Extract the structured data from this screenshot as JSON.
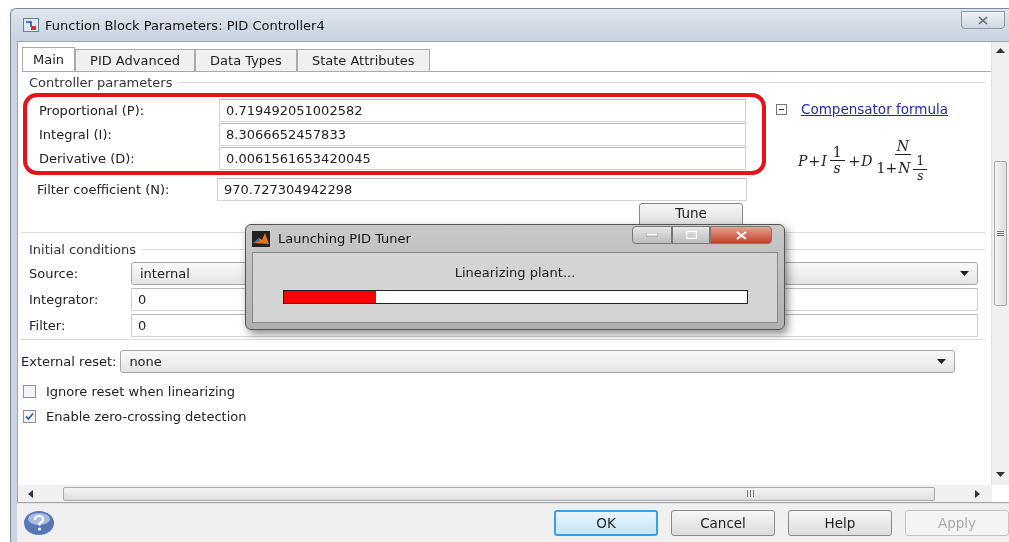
{
  "window": {
    "title": "Function Block Parameters: PID Controller4"
  },
  "tabs": [
    {
      "label": "Main",
      "selected": true
    },
    {
      "label": "PID Advanced",
      "selected": false
    },
    {
      "label": "Data Types",
      "selected": false
    },
    {
      "label": "State Attributes",
      "selected": false
    }
  ],
  "controller_parameters": {
    "title": "Controller parameters",
    "fields": [
      {
        "label": "Proportional (P):",
        "value": "0.719492051002582",
        "highlighted": true
      },
      {
        "label": "Integral (I):",
        "value": "8.3066652457833",
        "highlighted": true
      },
      {
        "label": "Derivative (D):",
        "value": "0.0061561653420045",
        "highlighted": true
      },
      {
        "label": "Filter coefficient (N):",
        "value": "970.727304942298",
        "highlighted": false
      }
    ]
  },
  "compensator": {
    "link": "Compensator formula",
    "expanded": true,
    "formula": [
      {
        "kind": "text",
        "text": "P"
      },
      {
        "kind": "text",
        "text": "+"
      },
      {
        "kind": "text",
        "text": "I"
      },
      {
        "kind": "frac",
        "num": [
          {
            "kind": "text",
            "text": "1"
          }
        ],
        "den": [
          {
            "kind": "text",
            "text": "s"
          }
        ]
      },
      {
        "kind": "text",
        "text": "+"
      },
      {
        "kind": "text",
        "text": "D"
      },
      {
        "kind": "frac",
        "num": [
          {
            "kind": "text",
            "text": "N"
          }
        ],
        "den": [
          {
            "kind": "text",
            "text": "1+"
          },
          {
            "kind": "text",
            "text": "N"
          },
          {
            "kind": "frac",
            "num": [
              {
                "kind": "text",
                "text": "1"
              }
            ],
            "den": [
              {
                "kind": "text",
                "text": "s"
              }
            ]
          }
        ]
      }
    ]
  },
  "tune_button": "Tune",
  "initial_conditions": {
    "title": "Initial conditions",
    "rows": [
      {
        "kind": "dropdown",
        "label": "Source:",
        "value": "internal"
      },
      {
        "kind": "input",
        "label": "Integrator:",
        "value": "0"
      },
      {
        "kind": "input",
        "label": "Filter:",
        "value": "0"
      }
    ]
  },
  "external_reset": {
    "label": "External reset:",
    "value": "none"
  },
  "checkboxes": [
    {
      "label": "Ignore reset when linearizing",
      "checked": false
    },
    {
      "label": "Enable zero-crossing detection",
      "checked": true
    }
  ],
  "buttons": [
    {
      "label": "OK",
      "default": true,
      "disabled": false
    },
    {
      "label": "Cancel",
      "default": false,
      "disabled": false
    },
    {
      "label": "Help",
      "default": false,
      "disabled": false
    },
    {
      "label": "Apply",
      "default": false,
      "disabled": true
    }
  ],
  "popup": {
    "title": "Launching PID Tuner",
    "message": "Linearizing plant...",
    "level": 0.2
  }
}
